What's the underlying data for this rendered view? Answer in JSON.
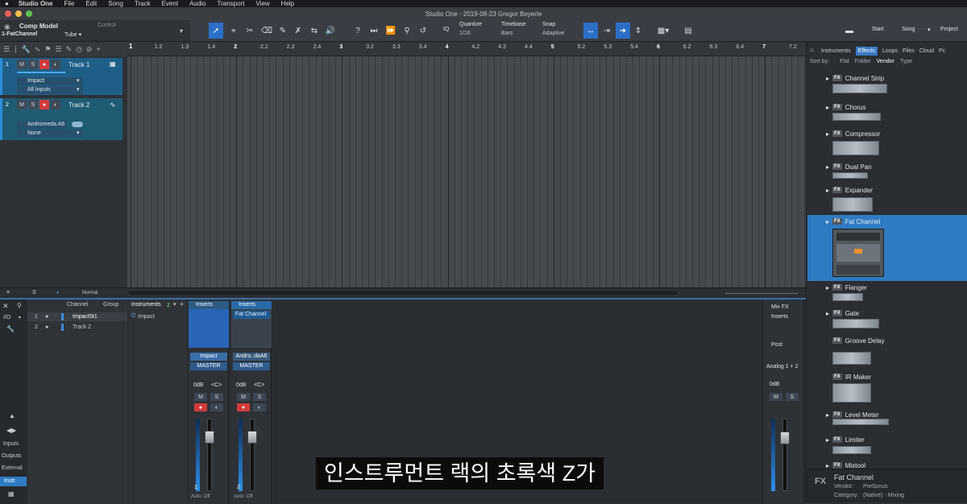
{
  "menubar": {
    "app": "Studio One",
    "items": [
      "File",
      "Edit",
      "Song",
      "Track",
      "Event",
      "Audio",
      "Transport",
      "View",
      "Help"
    ]
  },
  "window": {
    "title": "Studio One - 2019-08-23 Gregor Beyerle"
  },
  "preset": {
    "name": "Comp Model",
    "sub": "1-FatChannel",
    "control": "Control",
    "value": "Tube ▾"
  },
  "toolbar": {
    "quantize_label": "Quantize",
    "quantize_value": "1/16",
    "iq": "IQ",
    "timebase_label": "Timebase",
    "timebase_value": "Bars",
    "snap_label": "Snap",
    "snap_value": "Adaptive",
    "start": "Start",
    "song": "Song",
    "project": "Project"
  },
  "tracks": [
    {
      "num": "1",
      "name": "Track 1",
      "instrument": "Impact",
      "input": "All Inputs"
    },
    {
      "num": "2",
      "name": "Track 2",
      "instrument": "Andromeda A6",
      "input": "None"
    }
  ],
  "ruler": {
    "marks": [
      "1.2",
      "1.3",
      "1.4",
      "2",
      "2.2",
      "2.3",
      "2.4",
      "3",
      "3.2",
      "3.3",
      "3.4",
      "4",
      "4.2",
      "4.3",
      "4.4",
      "5",
      "5.2",
      "5.3",
      "5.4",
      "6",
      "6.2",
      "6.3",
      "6.4",
      "7",
      "7.2"
    ]
  },
  "arrange_footer": {
    "mode": "Normal"
  },
  "browser": {
    "tabs": [
      "Instruments",
      "Effects",
      "Loops",
      "Files",
      "Cloud",
      "Pc"
    ],
    "active_tab": "Effects",
    "sort_label": "Sort by:",
    "sort_options": [
      "Flat",
      "Folder",
      "Vendor",
      "Type"
    ],
    "fx_badge": "FX",
    "items": [
      "Channel Strip",
      "Chorus",
      "Compressor",
      "Dual Pan",
      "Expander",
      "Fat Channel",
      "Flanger",
      "Gate",
      "Groove Delay",
      "IR Maker",
      "Level Meter",
      "Limiter",
      "Mixtool"
    ],
    "selected": "Fat Channel",
    "info_title": "Fat Channel",
    "info_vendor_label": "Vendor:",
    "info_vendor": "PreSonus",
    "info_category_label": "Category:",
    "info_category": "(Native) · Mixing"
  },
  "console": {
    "io": "I/O",
    "col_channel": "Channel",
    "col_group": "Group",
    "col_instruments": "Instruments",
    "channels": [
      {
        "num": "1",
        "name": "Impact5t1"
      },
      {
        "num": "2",
        "name": "Track 2"
      }
    ],
    "instrument": "Impact",
    "side_labels": [
      "Inputs",
      "Outputs",
      "External",
      "Instr."
    ],
    "strips": [
      {
        "inserts": "Inserts",
        "slot": "",
        "name": "Impact",
        "out": "MASTER",
        "db": "0dB",
        "pan": "<C>",
        "num": "1"
      },
      {
        "inserts": "Inserts",
        "slot": "Fat Channel",
        "name": "Andro..daA6",
        "out": "MASTER",
        "db": "0dB",
        "pan": "<C>",
        "num": "2"
      }
    ],
    "auto": "Auto: Off",
    "mixfx": "Mix FX",
    "master_inserts": "Inserts",
    "post": "Post",
    "analog": "Analog 1 + 2",
    "master_db": "0dB",
    "mute": "M",
    "solo": "S"
  },
  "subtitle": "인스트루먼트 랙의 초록색 Z가"
}
